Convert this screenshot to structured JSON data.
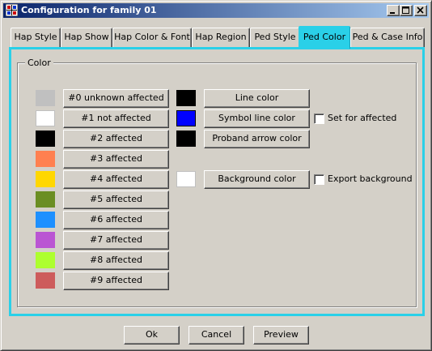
{
  "window": {
    "title": "Configuration for family 01",
    "controls": {
      "minimize": "minimize",
      "maximize": "maximize",
      "close": "close"
    }
  },
  "tabs": [
    {
      "label": "Hap Style",
      "active": false
    },
    {
      "label": "Hap Show",
      "active": false
    },
    {
      "label": "Hap Color & Font",
      "active": false
    },
    {
      "label": "Hap Region",
      "active": false
    },
    {
      "label": "Ped Style",
      "active": false
    },
    {
      "label": "Ped Color",
      "active": true
    },
    {
      "label": "Ped & Case Info",
      "active": false
    }
  ],
  "color_group": {
    "label": "Color",
    "affection_colors": [
      {
        "label": "#0 unknown affected",
        "color": "#c0c0c0"
      },
      {
        "label": "#1 not affected",
        "color": "#ffffff"
      },
      {
        "label": "#2 affected",
        "color": "#000000"
      },
      {
        "label": "#3 affected",
        "color": "#ff8050"
      },
      {
        "label": "#4 affected",
        "color": "#ffd700"
      },
      {
        "label": "#5 affected",
        "color": "#6b8e23"
      },
      {
        "label": "#6 affected",
        "color": "#1e90ff"
      },
      {
        "label": "#7 affected",
        "color": "#ba55d3"
      },
      {
        "label": "#8 affected",
        "color": "#adff2f"
      },
      {
        "label": "#9 affected",
        "color": "#cd5c5c"
      }
    ],
    "line_colors": [
      {
        "label": "Line color",
        "color": "#000000"
      },
      {
        "label": "Symbol line color",
        "color": "#0000ff"
      },
      {
        "label": "Proband arrow color",
        "color": "#000000"
      }
    ],
    "background": {
      "label": "Background color",
      "color": "#ffffff"
    },
    "set_for_affected": {
      "label": "Set for affected",
      "checked": false
    },
    "export_background": {
      "label": "Export background",
      "checked": false
    }
  },
  "footer": {
    "ok_label": "Ok",
    "cancel_label": "Cancel",
    "preview_label": "Preview"
  }
}
